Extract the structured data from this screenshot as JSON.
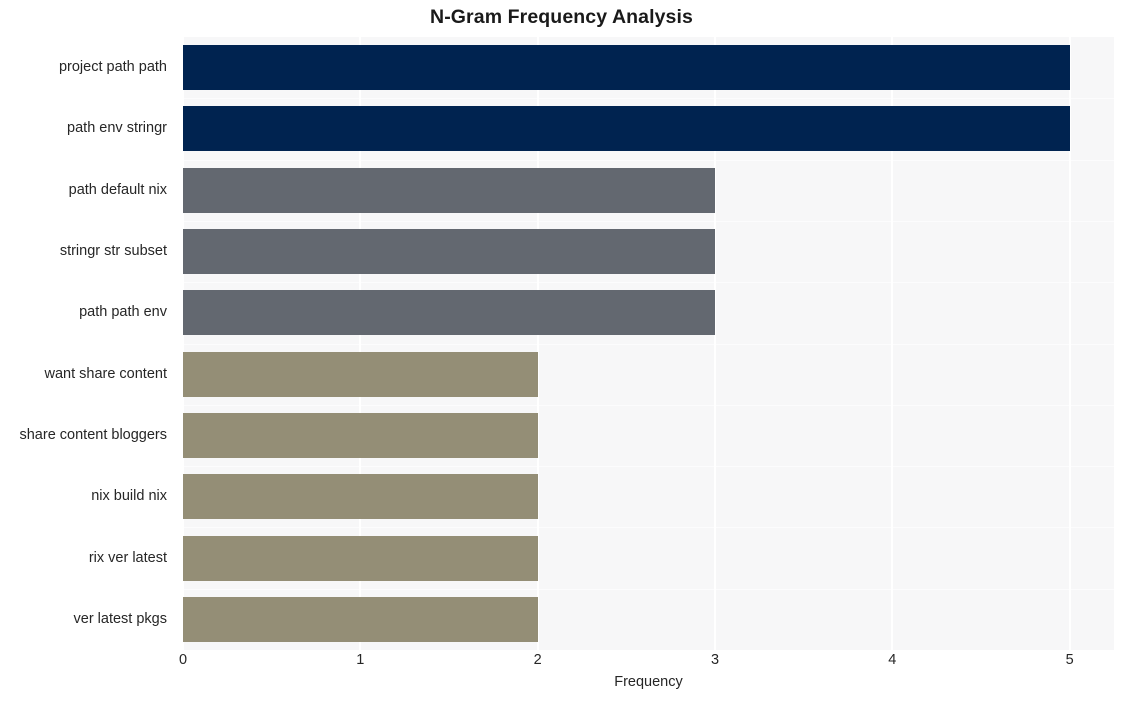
{
  "chart_data": {
    "type": "bar",
    "orientation": "horizontal",
    "title": "N-Gram Frequency Analysis",
    "xlabel": "Frequency",
    "ylabel": "",
    "categories": [
      "project path path",
      "path env stringr",
      "path default nix",
      "stringr str subset",
      "path path env",
      "want share content",
      "share content bloggers",
      "nix build nix",
      "rix ver latest",
      "ver latest pkgs"
    ],
    "values": [
      5,
      5,
      3,
      3,
      3,
      2,
      2,
      2,
      2,
      2
    ],
    "bar_colors": [
      "#002350",
      "#002350",
      "#636870",
      "#636870",
      "#636870",
      "#948e76",
      "#948e76",
      "#948e76",
      "#948e76",
      "#948e76"
    ],
    "xticks": [
      "0",
      "1",
      "2",
      "3",
      "4",
      "5"
    ],
    "xtick_values": [
      0,
      1,
      2,
      3,
      4,
      5
    ],
    "xlim": [
      0,
      5.25
    ],
    "grid": true,
    "grid_color": "#ffffff",
    "plot_background": "#f7f7f8",
    "figure_background": "#ffffff",
    "legend": null
  }
}
